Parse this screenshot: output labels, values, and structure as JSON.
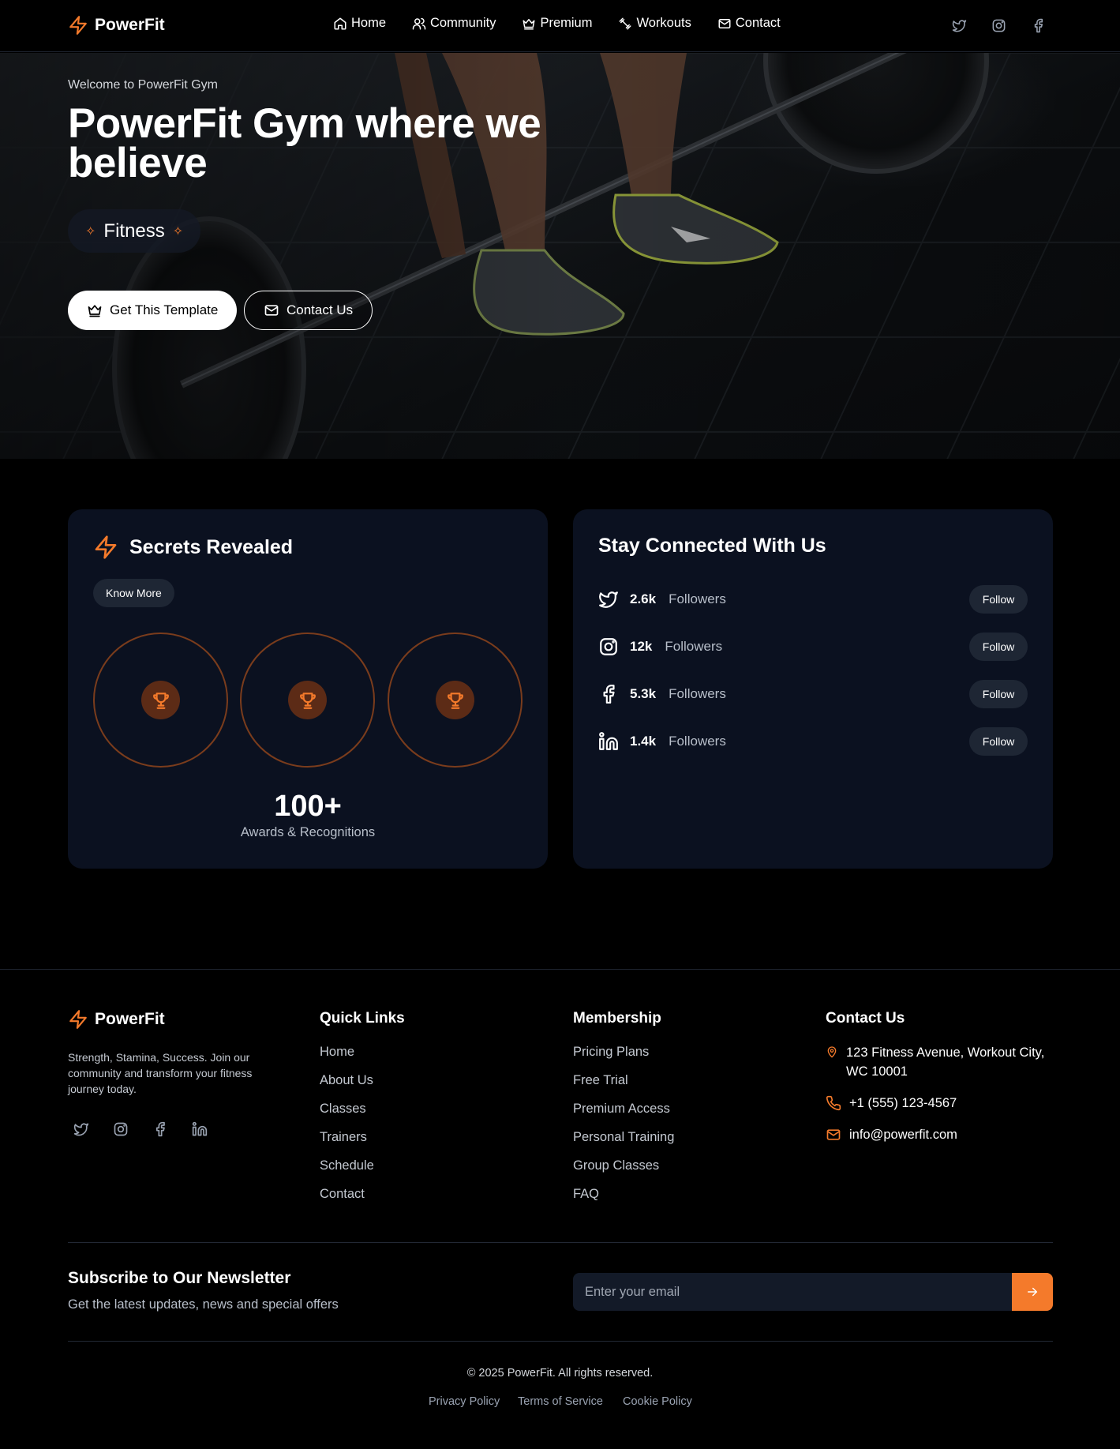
{
  "brand": {
    "name": "PowerFit",
    "accent": "#f47a2b"
  },
  "nav": {
    "links": [
      {
        "label": "Home",
        "icon": "home-icon"
      },
      {
        "label": "Community",
        "icon": "users-icon"
      },
      {
        "label": "Premium",
        "icon": "crown-icon"
      },
      {
        "label": "Workouts",
        "icon": "dumbbell-icon"
      },
      {
        "label": "Contact",
        "icon": "mail-icon"
      }
    ],
    "social": [
      "twitter-icon",
      "instagram-icon",
      "facebook-icon"
    ]
  },
  "hero": {
    "welcome": "Welcome to PowerFit Gym",
    "title": "PowerFit Gym where we believe",
    "pill": "Fitness",
    "primary_button": "Get This Template",
    "secondary_button": "Contact Us"
  },
  "secrets": {
    "title": "Secrets Revealed",
    "know_more": "Know More",
    "awards_value": "100+",
    "awards_label": "Awards & Recognitions"
  },
  "connected": {
    "title": "Stay Connected With Us",
    "rows": [
      {
        "icon": "twitter-icon",
        "count": "2.6k",
        "label": "Followers",
        "button": "Follow"
      },
      {
        "icon": "instagram-icon",
        "count": "12k",
        "label": "Followers",
        "button": "Follow"
      },
      {
        "icon": "facebook-icon",
        "count": "5.3k",
        "label": "Followers",
        "button": "Follow"
      },
      {
        "icon": "linkedin-icon",
        "count": "1.4k",
        "label": "Followers",
        "button": "Follow"
      }
    ]
  },
  "footer": {
    "brand": "PowerFit",
    "description": "Strength, Stamina, Success. Join our community and transform your fitness journey today.",
    "quick_links": {
      "title": "Quick Links",
      "items": [
        "Home",
        "About Us",
        "Classes",
        "Trainers",
        "Schedule",
        "Contact"
      ]
    },
    "membership": {
      "title": "Membership",
      "items": [
        "Pricing Plans",
        "Free Trial",
        "Premium Access",
        "Personal Training",
        "Group Classes",
        "FAQ"
      ]
    },
    "contact": {
      "title": "Contact Us",
      "address": "123 Fitness Avenue, Workout City, WC 10001",
      "phone": "+1 (555) 123-4567",
      "email": "info@powerfit.com"
    },
    "newsletter": {
      "title": "Subscribe to Our Newsletter",
      "subtitle": "Get the latest updates, news and special offers",
      "placeholder": "Enter your email"
    },
    "copyright": "© 2025 PowerFit. All rights reserved.",
    "legal": [
      "Privacy Policy",
      "Terms of Service",
      "Cookie Policy"
    ]
  }
}
